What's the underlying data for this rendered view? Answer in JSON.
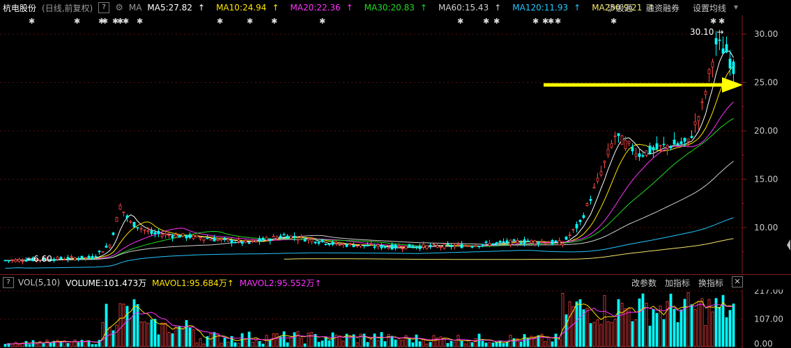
{
  "header": {
    "stock_name": "杭电股份",
    "period": "(日线,前复权)",
    "help_icon": "question-icon",
    "settings_icon": "gear-icon",
    "ma_label": "MA",
    "ma_items": [
      {
        "label": "MA5:27.82",
        "arrow": "↑",
        "color": "#ffffff"
      },
      {
        "label": "MA10:24.94",
        "arrow": "↑",
        "color": "#ffe400"
      },
      {
        "label": "MA20:22.36",
        "arrow": "↑",
        "color": "#ff33ff"
      },
      {
        "label": "MA30:20.83",
        "arrow": "↑",
        "color": "#22dd22"
      },
      {
        "label": "MA60:15.43",
        "arrow": "↑",
        "color": "#cfcfcf"
      },
      {
        "label": "MA120:11.93",
        "arrow": "↑",
        "color": "#22c8ff"
      },
      {
        "label": "MA250:9.21",
        "arrow": "↑",
        "color": "#f2e66a"
      }
    ],
    "menu": [
      "沪股通",
      "融资融券",
      "设置均线"
    ]
  },
  "price_chart": {
    "axis_ticks": [
      "30.00",
      "25.00",
      "20.00",
      "15.00",
      "10.00"
    ],
    "high_label": "30.10",
    "high_arrow": "→",
    "low_label": "6.60",
    "low_arrow": "←",
    "marker_glyph": "✱",
    "up_color": "#ff4444",
    "down_color": "#00ffff",
    "annotation_arrow_color": "#ffff00"
  },
  "volume": {
    "help_icon": "question-icon",
    "title": "VOL(5,10)",
    "volume_label": "VOLUME:101.473万",
    "mavol1_label": "MAVOL1:95.684万",
    "mavol2_label": "MAVOL2:95.552万",
    "arrow": "↑",
    "axis_ticks": [
      "217.00",
      "107.00",
      "0.00"
    ],
    "buttons": [
      "改参数",
      "加指标",
      "换指标"
    ],
    "close_label": "✕"
  }
}
